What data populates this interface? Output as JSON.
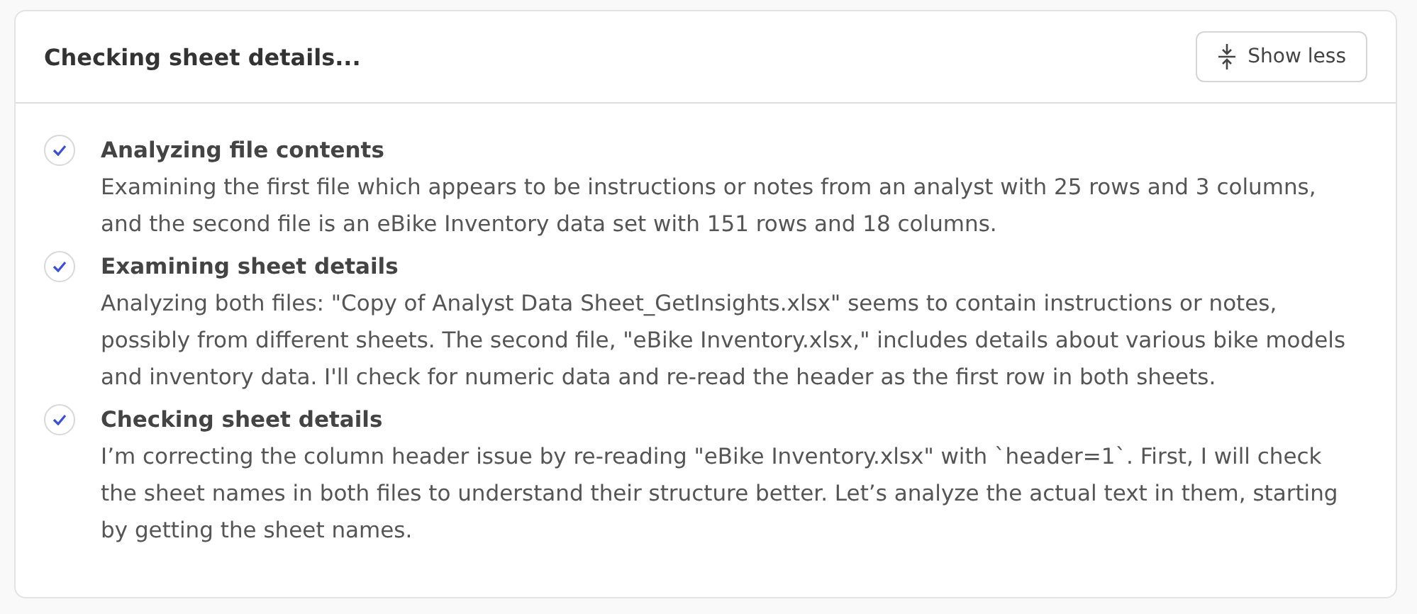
{
  "header": {
    "title": "Checking sheet details...",
    "toggle_button": "Show less"
  },
  "steps": [
    {
      "title": "Analyzing file contents",
      "done": true,
      "text": "Examining the first file which appears to be instructions or notes from an analyst with 25 rows and 3 columns, and the second file is an eBike Inventory data set with 151 rows and 18 columns."
    },
    {
      "title": "Examining sheet details",
      "done": true,
      "text": "Analyzing both files: \"Copy of Analyst Data Sheet_GetInsights.xlsx\" seems to contain instructions or notes, possibly from different sheets. The second file, \"eBike Inventory.xlsx,\" includes details about various bike models and inventory data. I'll check for numeric data and re-read the header as the first row in both sheets."
    },
    {
      "title": "Checking sheet details",
      "done": true,
      "text": "I’m correcting the column header issue by re-reading \"eBike Inventory.xlsx\" with `header=1`. First, I will check the sheet names in both files to understand their structure better. Let’s analyze the actual text in them, starting by getting the sheet names."
    }
  ]
}
